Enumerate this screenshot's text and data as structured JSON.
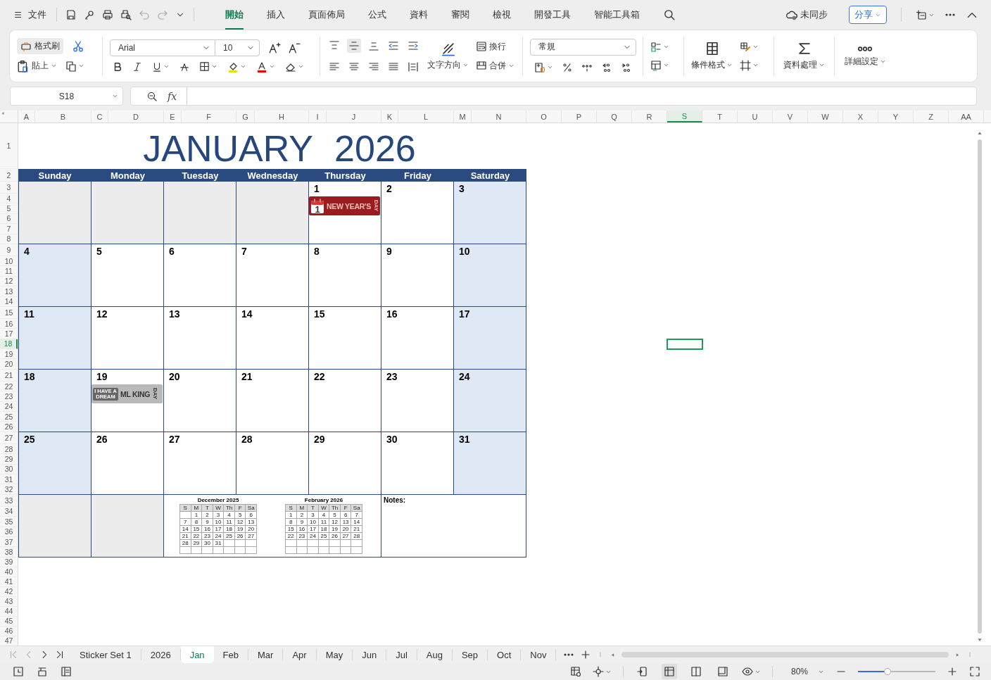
{
  "menu_bar": {
    "file_menu": "文件",
    "tabs": [
      {
        "label": "開始",
        "selected": true
      },
      {
        "label": "插入",
        "selected": false
      },
      {
        "label": "頁面佈局",
        "selected": false
      },
      {
        "label": "公式",
        "selected": false
      },
      {
        "label": "資料",
        "selected": false
      },
      {
        "label": "審閱",
        "selected": false
      },
      {
        "label": "檢視",
        "selected": false
      },
      {
        "label": "開發工具",
        "selected": false
      },
      {
        "label": "智能工具箱",
        "selected": false
      }
    ],
    "sync_status": "未同步",
    "share_button": "分享"
  },
  "ribbon": {
    "format_painter": "格式刷",
    "paste": "貼上",
    "font_name": "Arial",
    "font_size": "10",
    "vertical_align": [
      {
        "kind": "top",
        "selected": false
      },
      {
        "kind": "middle",
        "selected": true
      },
      {
        "kind": "bottom",
        "selected": false
      }
    ],
    "wrap_text": "換行",
    "text_direction": "文字方向",
    "merge": "合併",
    "number_format": "常規",
    "conditional_format": "條件格式",
    "data_processing": "資料處理",
    "more_settings": "詳細設定"
  },
  "formula_bar": {
    "name_box": "S18",
    "function_label": "fx"
  },
  "sheet": {
    "columns": [
      {
        "label": "A",
        "selected": false
      },
      {
        "label": "B",
        "selected": false
      },
      {
        "label": "C",
        "selected": false
      },
      {
        "label": "D",
        "selected": false
      },
      {
        "label": "E",
        "selected": false
      },
      {
        "label": "F",
        "selected": false
      },
      {
        "label": "G",
        "selected": false
      },
      {
        "label": "H",
        "selected": false
      },
      {
        "label": "I",
        "selected": false
      },
      {
        "label": "J",
        "selected": false
      },
      {
        "label": "K",
        "selected": false
      },
      {
        "label": "L",
        "selected": false
      },
      {
        "label": "M",
        "selected": false
      },
      {
        "label": "N",
        "selected": false
      },
      {
        "label": "O",
        "selected": false
      },
      {
        "label": "P",
        "selected": false
      },
      {
        "label": "Q",
        "selected": false
      },
      {
        "label": "R",
        "selected": false
      },
      {
        "label": "S",
        "selected": true
      },
      {
        "label": "T",
        "selected": false
      },
      {
        "label": "U",
        "selected": false
      },
      {
        "label": "V",
        "selected": false
      },
      {
        "label": "W",
        "selected": false
      },
      {
        "label": "X",
        "selected": false
      },
      {
        "label": "Y",
        "selected": false
      },
      {
        "label": "Z",
        "selected": false
      },
      {
        "label": "AA",
        "selected": false
      }
    ],
    "rows": [
      {
        "label": "1",
        "selected": false
      },
      {
        "label": "2",
        "selected": false
      },
      {
        "label": "3",
        "selected": false
      },
      {
        "label": "4",
        "selected": false
      },
      {
        "label": "5",
        "selected": false
      },
      {
        "label": "6",
        "selected": false
      },
      {
        "label": "7",
        "selected": false
      },
      {
        "label": "8",
        "selected": false
      },
      {
        "label": "9",
        "selected": false
      },
      {
        "label": "10",
        "selected": false
      },
      {
        "label": "11",
        "selected": false
      },
      {
        "label": "12",
        "selected": false
      },
      {
        "label": "13",
        "selected": false
      },
      {
        "label": "14",
        "selected": false
      },
      {
        "label": "15",
        "selected": false
      },
      {
        "label": "16",
        "selected": false
      },
      {
        "label": "17",
        "selected": false
      },
      {
        "label": "18",
        "selected": true
      },
      {
        "label": "19",
        "selected": false
      },
      {
        "label": "20",
        "selected": false
      },
      {
        "label": "21",
        "selected": false
      },
      {
        "label": "22",
        "selected": false
      },
      {
        "label": "23",
        "selected": false
      },
      {
        "label": "24",
        "selected": false
      },
      {
        "label": "25",
        "selected": false
      },
      {
        "label": "26",
        "selected": false
      },
      {
        "label": "27",
        "selected": false
      },
      {
        "label": "28",
        "selected": false
      },
      {
        "label": "29",
        "selected": false
      },
      {
        "label": "30",
        "selected": false
      },
      {
        "label": "31",
        "selected": false
      },
      {
        "label": "32",
        "selected": false
      },
      {
        "label": "33",
        "selected": false
      },
      {
        "label": "34",
        "selected": false
      },
      {
        "label": "35",
        "selected": false
      },
      {
        "label": "36",
        "selected": false
      },
      {
        "label": "37",
        "selected": false
      },
      {
        "label": "38",
        "selected": false
      },
      {
        "label": "39",
        "selected": false
      },
      {
        "label": "40",
        "selected": false
      },
      {
        "label": "41",
        "selected": false
      },
      {
        "label": "42",
        "selected": false
      },
      {
        "label": "43",
        "selected": false
      },
      {
        "label": "44",
        "selected": false
      },
      {
        "label": "45",
        "selected": false
      },
      {
        "label": "46",
        "selected": false
      },
      {
        "label": "47",
        "selected": false
      }
    ],
    "calendar": {
      "month": "JANUARY",
      "year": "2026",
      "weekdays": [
        {
          "label": "Sunday",
          "weekend": true
        },
        {
          "label": "Monday",
          "weekend": false
        },
        {
          "label": "Tuesday",
          "weekend": false
        },
        {
          "label": "Wednesday",
          "weekend": false
        },
        {
          "label": "Thursday",
          "weekend": false
        },
        {
          "label": "Friday",
          "weekend": false
        },
        {
          "label": "Saturday",
          "weekend": true
        }
      ],
      "weeks": [
        {
          "kind": "first",
          "days": [
            {
              "day": "1",
              "sticker": {
                "kind": "calendar-banner",
                "color": "#9b1c20",
                "icon_text": "1",
                "text": "NEW YEAR'S",
                "side_text": "DAY"
              }
            },
            {
              "day": "2"
            },
            {
              "day": "3"
            }
          ]
        },
        {
          "kind": "regular",
          "days": [
            {
              "day": "4"
            },
            {
              "day": "5"
            },
            {
              "day": "6"
            },
            {
              "day": "7"
            },
            {
              "day": "8"
            },
            {
              "day": "9"
            },
            {
              "day": "10"
            }
          ]
        },
        {
          "kind": "regular",
          "days": [
            {
              "day": "11"
            },
            {
              "day": "12"
            },
            {
              "day": "13"
            },
            {
              "day": "14"
            },
            {
              "day": "15"
            },
            {
              "day": "16"
            },
            {
              "day": "17"
            }
          ]
        },
        {
          "kind": "regular",
          "days": [
            {
              "day": "18"
            },
            {
              "day": "19",
              "sticker": {
                "kind": "badge-banner",
                "color": "#b9b9b9",
                "badge_text": "I HAVE A DREAM",
                "text": "ML KING",
                "side_text": "DAY"
              }
            },
            {
              "day": "20"
            },
            {
              "day": "21"
            },
            {
              "day": "22"
            },
            {
              "day": "23"
            },
            {
              "day": "24"
            }
          ]
        },
        {
          "kind": "regular",
          "days": [
            {
              "day": "25"
            },
            {
              "day": "26"
            },
            {
              "day": "27"
            },
            {
              "day": "28"
            },
            {
              "day": "29"
            },
            {
              "day": "30"
            },
            {
              "day": "31"
            }
          ]
        }
      ],
      "mini_calendars": [
        {
          "title": "December 2025",
          "headers": [
            "S",
            "M",
            "T",
            "W",
            "Th",
            "F",
            "Sa"
          ],
          "weeks": [
            {
              "kind": "first",
              "days": [
                "1",
                "2",
                "3",
                "4",
                "5",
                "6"
              ]
            },
            {
              "kind": "regular",
              "days": [
                "7",
                "8",
                "9",
                "10",
                "11",
                "12",
                "13"
              ]
            },
            {
              "kind": "regular",
              "days": [
                "14",
                "15",
                "16",
                "17",
                "18",
                "19",
                "20"
              ]
            },
            {
              "kind": "regular",
              "days": [
                "21",
                "22",
                "23",
                "24",
                "25",
                "26",
                "27"
              ]
            },
            {
              "kind": "regular",
              "days": [
                "28",
                "29",
                "30",
                "31"
              ]
            }
          ]
        },
        {
          "title": "February 2026",
          "headers": [
            "S",
            "M",
            "T",
            "W",
            "Th",
            "F",
            "Sa"
          ],
          "weeks": [
            {
              "kind": "first",
              "days": [
                "1",
                "2",
                "3",
                "4",
                "5",
                "6",
                "7"
              ]
            },
            {
              "kind": "regular",
              "days": [
                "8",
                "9",
                "10",
                "11",
                "12",
                "13",
                "14"
              ]
            },
            {
              "kind": "regular",
              "days": [
                "15",
                "16",
                "17",
                "18",
                "19",
                "20",
                "21"
              ]
            },
            {
              "kind": "regular",
              "days": [
                "22",
                "23",
                "24",
                "25",
                "26",
                "27",
                "28"
              ]
            }
          ]
        }
      ],
      "notes_label": "Notes:"
    }
  },
  "sheet_tabs": {
    "tabs": [
      {
        "label": "Sticker Set 1",
        "selected": false
      },
      {
        "label": "2026",
        "selected": false
      },
      {
        "label": "Jan",
        "selected": true
      },
      {
        "label": "Feb",
        "selected": false
      },
      {
        "label": "Mar",
        "selected": false
      },
      {
        "label": "Apr",
        "selected": false
      },
      {
        "label": "May",
        "selected": false
      },
      {
        "label": "Jun",
        "selected": false
      },
      {
        "label": "Jul",
        "selected": false
      },
      {
        "label": "Aug",
        "selected": false
      },
      {
        "label": "Sep",
        "selected": false
      },
      {
        "label": "Oct",
        "selected": false
      },
      {
        "label": "Nov",
        "selected": false
      }
    ]
  },
  "status_bar": {
    "view_modes": [
      {
        "kind": "reading",
        "selected": false
      },
      {
        "kind": "normal",
        "selected": true
      },
      {
        "kind": "split",
        "selected": false
      },
      {
        "kind": "page",
        "selected": false
      }
    ],
    "zoom": "80%",
    "zoom_slider": {
      "level": 0.38
    }
  }
}
